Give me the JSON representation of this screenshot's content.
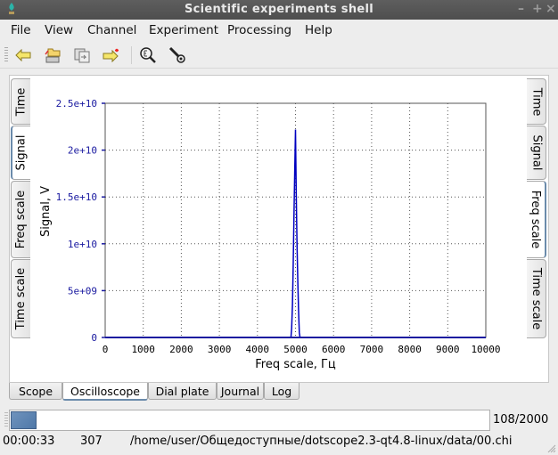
{
  "window": {
    "title": "Scientific experiments shell",
    "controls": [
      "minimize",
      "maximize",
      "close"
    ]
  },
  "menubar": {
    "items": [
      "File",
      "View",
      "Channel",
      "Experiment",
      "Processing",
      "Help"
    ]
  },
  "toolbar": {
    "buttons": [
      {
        "icon": "back-arrow-icon"
      },
      {
        "icon": "open-folder-icon"
      },
      {
        "icon": "copy-document-icon"
      },
      {
        "icon": "forward-arrow-icon"
      },
      {
        "icon": "zoom-icon"
      },
      {
        "icon": "probe-icon"
      }
    ]
  },
  "left_tabs": [
    {
      "label": "Time",
      "active": false
    },
    {
      "label": "Signal",
      "active": true
    },
    {
      "label": "Freq scale",
      "active": false
    },
    {
      "label": "Time scale",
      "active": false
    }
  ],
  "right_tabs": [
    {
      "label": "Time",
      "active": false
    },
    {
      "label": "Signal",
      "active": false
    },
    {
      "label": "Freq scale",
      "active": true
    },
    {
      "label": "Time scale",
      "active": false
    }
  ],
  "bottom_tabs": [
    {
      "label": "Scope",
      "active": false
    },
    {
      "label": "Oscilloscope",
      "active": true
    },
    {
      "label": "Dial plate",
      "active": false
    },
    {
      "label": "Journal",
      "active": false
    },
    {
      "label": "Log",
      "active": false
    }
  ],
  "chart_data": {
    "type": "line",
    "title": "",
    "xlabel": "Freq scale, Гц",
    "ylabel": "Signal, V",
    "xlim": [
      0,
      10000
    ],
    "ylim": [
      0,
      25000000000.0
    ],
    "grid": true,
    "x_ticks": [
      0,
      1000,
      2000,
      3000,
      4000,
      5000,
      6000,
      7000,
      8000,
      9000,
      10000
    ],
    "x_tick_labels": [
      "0",
      "1000",
      "2000",
      "3000",
      "4000",
      "5000",
      "6000",
      "7000",
      "8000",
      "9000",
      "10000"
    ],
    "y_ticks": [
      0,
      5000000000.0,
      10000000000.0,
      15000000000.0,
      20000000000.0,
      25000000000.0
    ],
    "y_tick_labels": [
      "0",
      "5e+09",
      "1e+10",
      "1.5e+10",
      "2e+10",
      "2.5e+10"
    ],
    "series": [
      {
        "name": "Signal",
        "color": "#0000c0",
        "x": [
          0,
          4880,
          4900,
          4920,
          4940,
          4960,
          4980,
          5000,
          5020,
          5040,
          5060,
          5080,
          5100,
          5120,
          10000
        ],
        "y": [
          0,
          0,
          1000000000.0,
          3500000000.0,
          7500000000.0,
          13000000000.0,
          17500000000.0,
          22200000000.0,
          15000000000.0,
          10000000000.0,
          6000000000.0,
          3000000000.0,
          500000000.0,
          0,
          0
        ]
      }
    ]
  },
  "progress": {
    "current": 108,
    "total": 2000,
    "text": "108/2000",
    "fraction": 0.054
  },
  "status": {
    "elapsed": "00:00:33",
    "count": "307",
    "path": "/home/user/Общедоступные/dotscope2.3-qt4.8-linux/data/00.chi"
  },
  "colors": {
    "accent": "#6b8bab",
    "plot_line": "#0000c0",
    "tick_label": "#1a1aa0"
  }
}
